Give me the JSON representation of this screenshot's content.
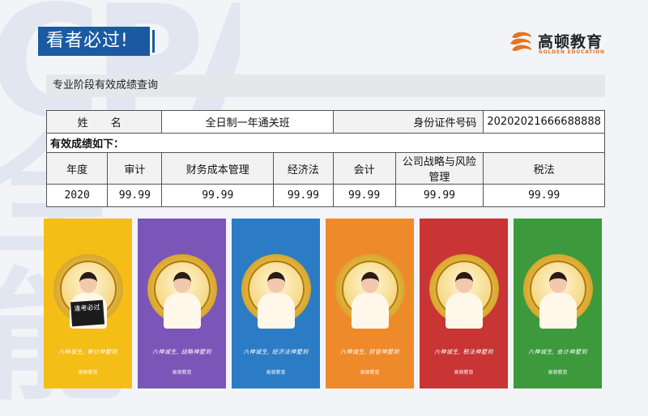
{
  "badge_title": "看者必过!",
  "logo": {
    "name_cn": "高顿教育",
    "name_en": "GOLDEN EDUCATION",
    "accent": "#e8731c"
  },
  "section_header": "专业阶段有效成绩查询",
  "table": {
    "name_label": "姓    名",
    "name_value": "全日制一年通关班",
    "id_label": "身份证件号码",
    "id_value": "20202021666688888",
    "note": "有效成绩如下：",
    "headers": [
      "年度",
      "审计",
      "财务成本管理",
      "经济法",
      "会计",
      "公司战略与风险管理",
      "税法"
    ],
    "values": [
      "2020",
      "99.99",
      "99.99",
      "99.99",
      "99.99",
      "99.99",
      "99.99"
    ]
  },
  "cards": [
    {
      "color": "#f5be16",
      "slogan": "六种诚生, 审计神墅到",
      "sign": "逢考必过"
    },
    {
      "color": "#7b56b8",
      "slogan": "六神诚生, 战略神墅到"
    },
    {
      "color": "#2b7cc4",
      "slogan": "六神诚生, 经济法神墅到"
    },
    {
      "color": "#ef8a2a",
      "slogan": "六神诚生, 财管神墅到"
    },
    {
      "color": "#c93434",
      "slogan": "六神诚生, 税法神墅到"
    },
    {
      "color": "#3c9a3c",
      "slogan": "六神诚生, 会计神墅到"
    }
  ],
  "card_brand": "高顿教育",
  "colors": {
    "badge": "#1b5aa3",
    "header_bg": "#e6e7ea"
  }
}
